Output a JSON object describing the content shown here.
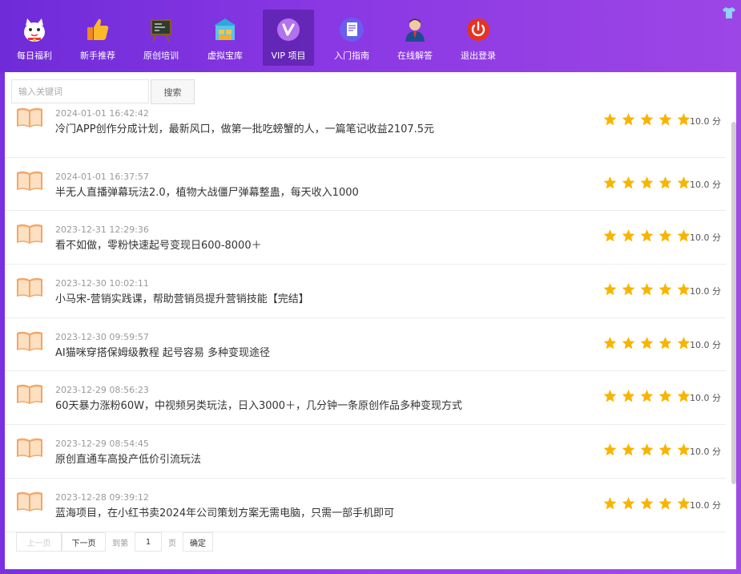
{
  "nav": [
    {
      "label": "每日福利",
      "icon": "lucky-cat-icon"
    },
    {
      "label": "新手推荐",
      "icon": "thumbs-up-icon"
    },
    {
      "label": "原创培训",
      "icon": "chalkboard-icon"
    },
    {
      "label": "虚拟宝库",
      "icon": "treasure-house-icon"
    },
    {
      "label": "VIP 项目",
      "icon": "vip-icon"
    },
    {
      "label": "入门指南",
      "icon": "document-icon"
    },
    {
      "label": "在线解答",
      "icon": "agent-icon"
    },
    {
      "label": "退出登录",
      "icon": "power-icon"
    }
  ],
  "active_nav": "VIP 项目",
  "search": {
    "placeholder": "输入关键词",
    "button": "搜索"
  },
  "items": [
    {
      "date": "2024-01-01 16:42:42",
      "title": "冷门APP创作分成计划，最新风口，做第一批吃螃蟹的人，一篇笔记收益2107.5元",
      "rating": 5,
      "score": "10.0 分"
    },
    {
      "date": "2024-01-01 16:37:57",
      "title": "半无人直播弹幕玩法2.0，植物大战僵尸弹幕整蛊，每天收入1000",
      "rating": 5,
      "score": "10.0 分"
    },
    {
      "date": "2023-12-31 12:29:36",
      "title": "看不如做，零粉快速起号变现日600-8000＋",
      "rating": 5,
      "score": "10.0 分"
    },
    {
      "date": "2023-12-30 10:02:11",
      "title": "小马宋-营销实践课，帮助营销员提升营销技能【完结】",
      "rating": 5,
      "score": "10.0 分"
    },
    {
      "date": "2023-12-30 09:59:57",
      "title": "AI猫咪穿搭保姆级教程 起号容易 多种变现途径",
      "rating": 5,
      "score": "10.0 分"
    },
    {
      "date": "2023-12-29 08:56:23",
      "title": "60天暴力涨粉60W，中视频另类玩法，日入3000＋，几分钟一条原创作品多种变现方式",
      "rating": 5,
      "score": "10.0 分"
    },
    {
      "date": "2023-12-29 08:54:45",
      "title": "原创直通车高投产低价引流玩法",
      "rating": 5,
      "score": "10.0 分"
    },
    {
      "date": "2023-12-28 09:39:12",
      "title": "蓝海项目，在小红书卖2024年公司策划方案无需电脑，只需一部手机即可",
      "rating": 5,
      "score": "10.0 分"
    }
  ],
  "pager": {
    "prev": "上一页",
    "next": "下一页",
    "goto": "到第",
    "page": "1",
    "unit": "页",
    "ok": "确定"
  },
  "colors": {
    "star": "#f7b500",
    "accent": "#8a38e3"
  }
}
